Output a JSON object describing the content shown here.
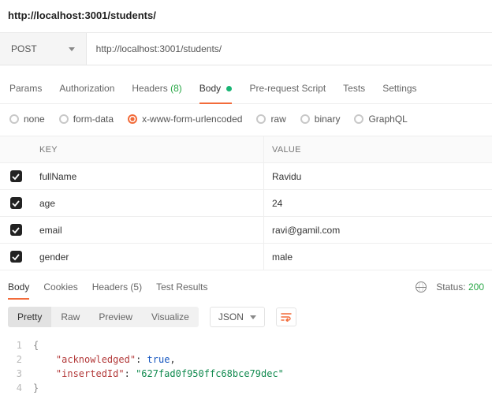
{
  "title": "http://localhost:3001/students/",
  "request": {
    "method": "POST",
    "url": "http://localhost:3001/students/"
  },
  "tabs": {
    "params": "Params",
    "auth": "Authorization",
    "headers": {
      "label": "Headers",
      "count": "(8)"
    },
    "body": "Body",
    "prereq": "Pre-request Script",
    "tests": "Tests",
    "settings": "Settings"
  },
  "bodyTypes": {
    "none": "none",
    "formdata": "form-data",
    "urlencoded": "x-www-form-urlencoded",
    "raw": "raw",
    "binary": "binary",
    "graphql": "GraphQL"
  },
  "kv": {
    "keyHeader": "KEY",
    "valueHeader": "VALUE",
    "rows": [
      {
        "key": "fullName",
        "value": "Ravidu"
      },
      {
        "key": "age",
        "value": "24"
      },
      {
        "key": "email",
        "value": "ravi@gamil.com"
      },
      {
        "key": "gender",
        "value": "male"
      }
    ]
  },
  "respTabs": {
    "body": "Body",
    "cookies": "Cookies",
    "headers": {
      "label": "Headers",
      "count": "(5)"
    },
    "testresults": "Test Results"
  },
  "status": {
    "label": "Status:",
    "value": "200"
  },
  "viewModes": {
    "pretty": "Pretty",
    "raw": "Raw",
    "preview": "Preview",
    "visualize": "Visualize",
    "lang": "JSON"
  },
  "response": {
    "l1": "{",
    "pad": "    ",
    "k1": "\"acknowledged\"",
    "v1": "true",
    "k2": "\"insertedId\"",
    "v2": "\"627fad0f950ffc68bce79dec\"",
    "l4": "}"
  }
}
